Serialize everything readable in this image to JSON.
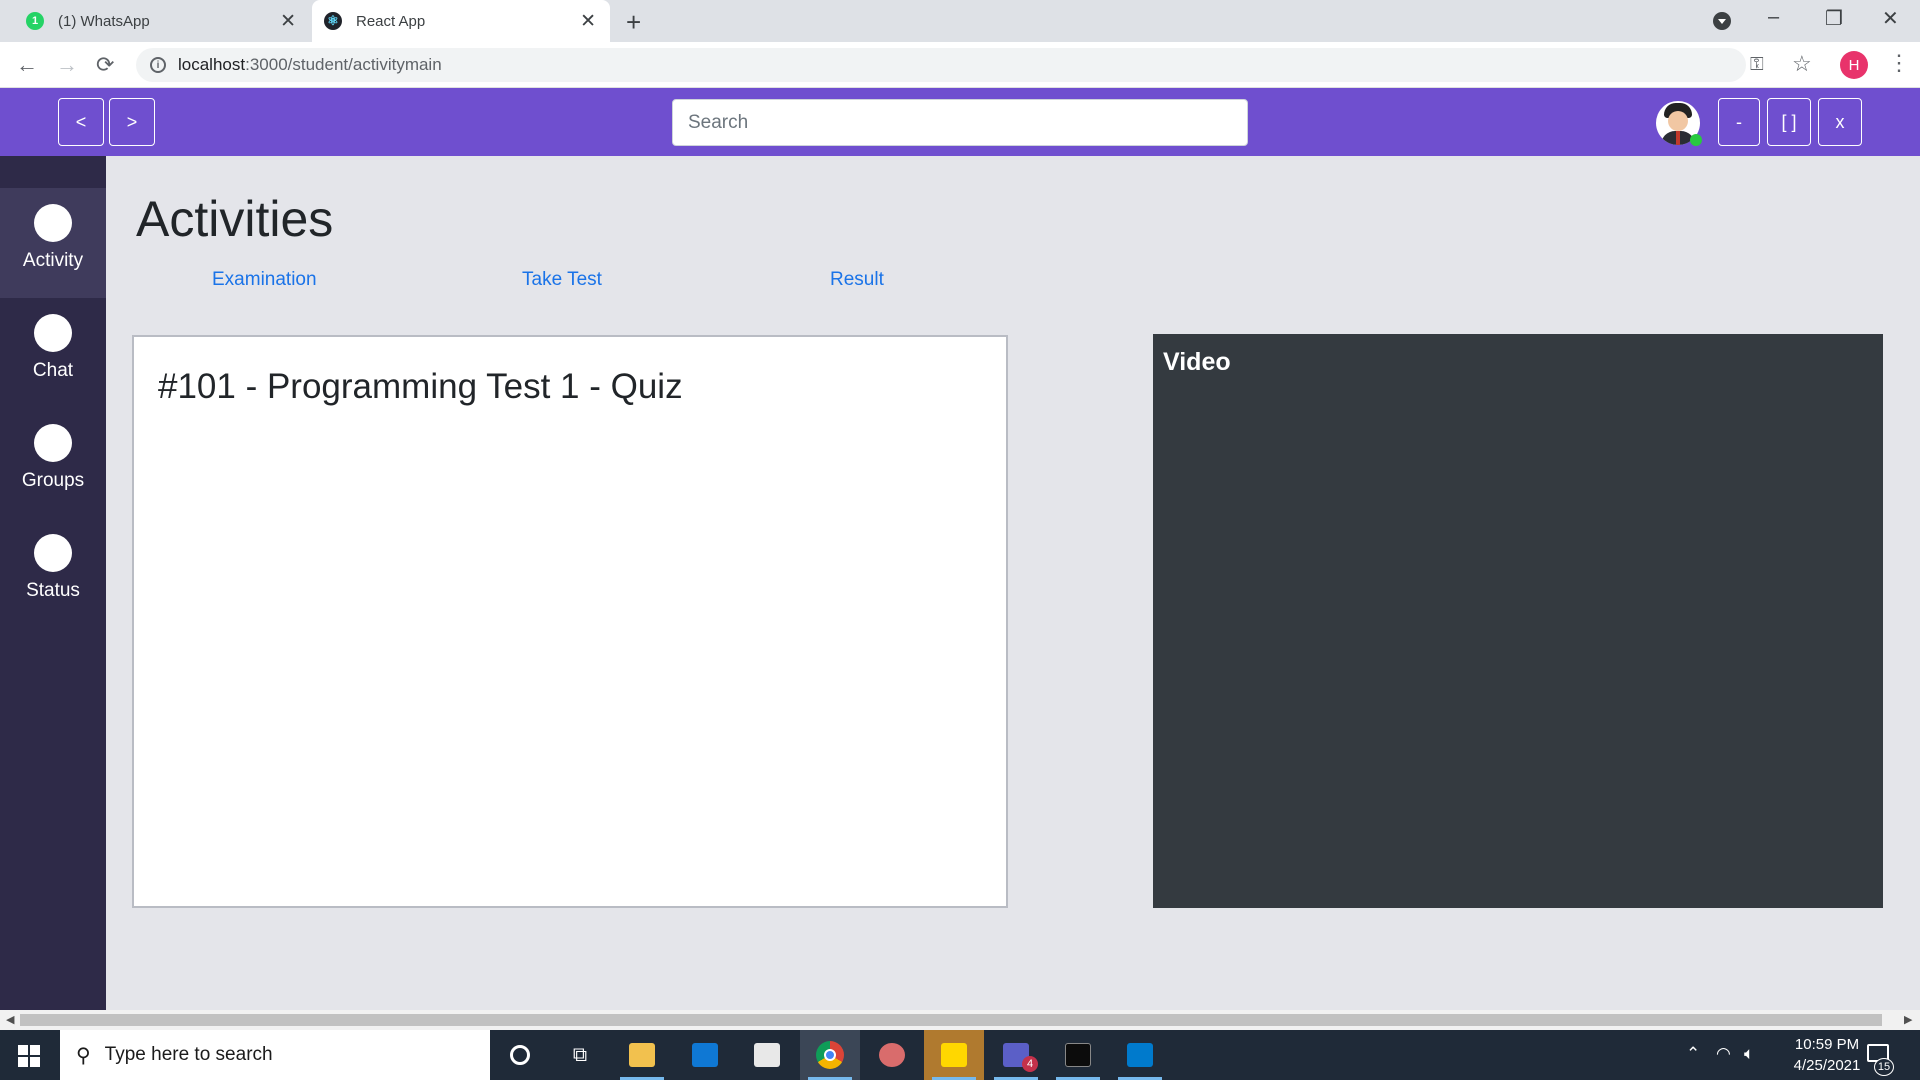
{
  "browser": {
    "tabs": [
      {
        "title": "(1) WhatsApp",
        "badge": "1"
      },
      {
        "title": "React App"
      }
    ],
    "new_tab": "+",
    "url_host": "localhost",
    "url_path": ":3000/student/activitymain",
    "profile_initial": "H",
    "window_controls": {
      "minimize": "–",
      "restore": "❐",
      "close": "✕"
    },
    "nav": {
      "back": "←",
      "forward": "→",
      "reload": "⟳"
    }
  },
  "header": {
    "back_label": "<",
    "forward_label": ">",
    "search_placeholder": "Search",
    "minimize_label": "-",
    "maximize_label": "[ ]",
    "close_label": "x",
    "accent_color": "#6f4fcf"
  },
  "sidebar": {
    "items": [
      {
        "label": "Activity",
        "active": true
      },
      {
        "label": "Chat"
      },
      {
        "label": "Groups"
      },
      {
        "label": "Status"
      }
    ]
  },
  "main": {
    "title": "Activities",
    "links": [
      {
        "label": "Examination"
      },
      {
        "label": "Take Test"
      },
      {
        "label": "Result"
      }
    ],
    "exam_card": {
      "title": "#101 - Programming Test 1 - Quiz"
    },
    "video_panel": {
      "label": "Video"
    }
  },
  "taskbar": {
    "search_placeholder": "Type here to search",
    "time": "10:59 PM",
    "date": "4/25/2021",
    "notification_count": "15",
    "teams_badge": "4",
    "apps": [
      "cortana-icon",
      "task-view-icon",
      "file-explorer-icon",
      "mail-icon",
      "store-icon",
      "chrome-icon",
      "paint-icon",
      "sticky-notes-icon",
      "teams-icon",
      "terminal-icon",
      "vscode-icon"
    ]
  }
}
